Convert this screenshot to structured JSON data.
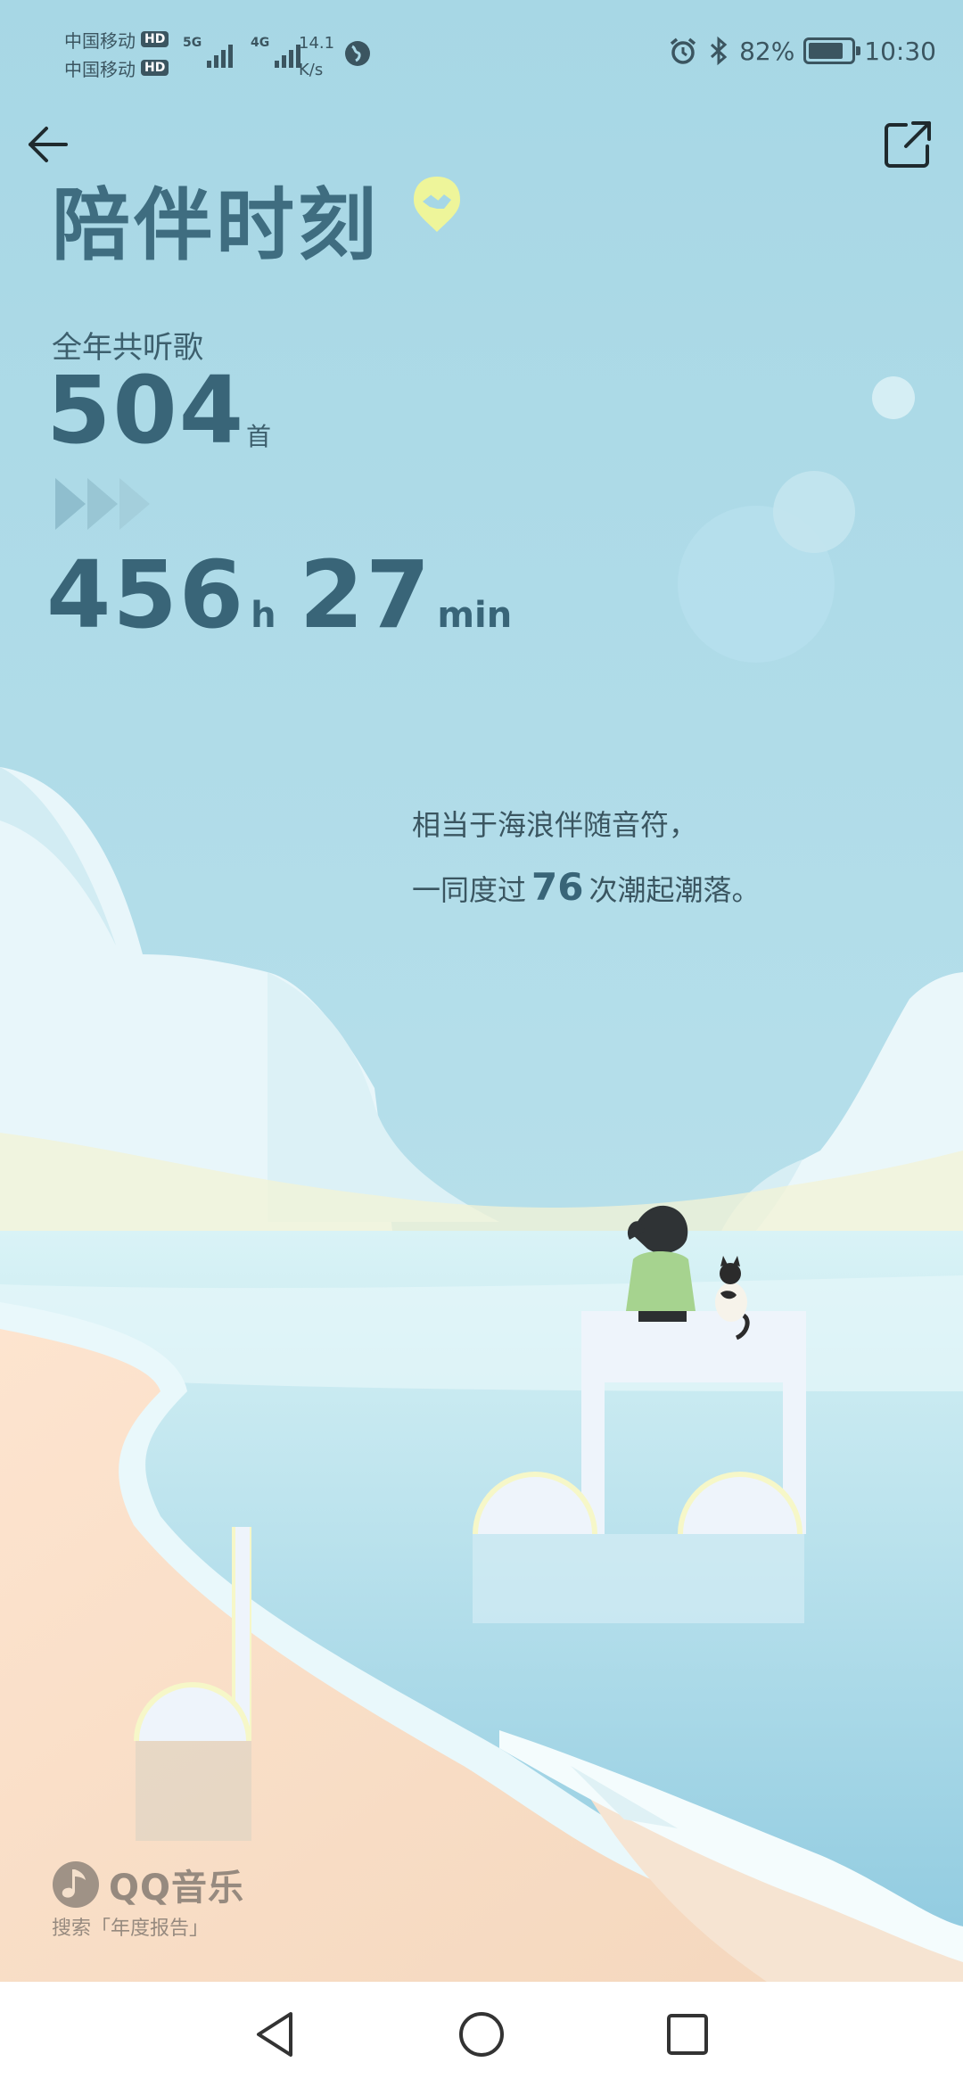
{
  "status_bar": {
    "carrier_1": "中国移动",
    "carrier_2": "中国移动",
    "hd_badge": "HD",
    "signal_1_tag": "5G",
    "signal_2_tag": "4G",
    "net_speed_value": "14.1",
    "net_speed_unit": "K/s",
    "battery_percent": "82%",
    "battery_level": 0.82,
    "time": "10:30",
    "icons": [
      "globe-icon",
      "alarm-icon",
      "bluetooth-icon",
      "battery-icon"
    ]
  },
  "header": {
    "back_icon": "arrow-left-icon",
    "share_icon": "share-external-icon",
    "title": "陪伴时刻",
    "title_badge_icon": "handshake-badge-icon"
  },
  "stats": {
    "total_label": "全年共听歌",
    "song_count": "504",
    "song_unit": "首",
    "arrows_icon": "triple-arrow-icon",
    "hours": "456",
    "hours_unit": "h",
    "minutes": "27",
    "minutes_unit": "min"
  },
  "description": {
    "line1": "相当于海浪伴随音符，",
    "line2_prefix": "一同度过",
    "line2_highlight": "76",
    "line2_suffix": "次潮起潮落。"
  },
  "brand": {
    "name": "QQ音乐",
    "hint": "搜索「年度报告」",
    "logo_icon": "qq-music-logo-icon"
  },
  "nav_bar": {
    "back_icon": "nav-back-triangle-icon",
    "home_icon": "nav-home-circle-icon",
    "recent_icon": "nav-recent-square-icon"
  },
  "colors": {
    "sky": "#a9d8e6",
    "title": "#3f6d80",
    "text": "#3a5560",
    "sand": "#f8dcc4",
    "sea": "#bfe6ef"
  }
}
